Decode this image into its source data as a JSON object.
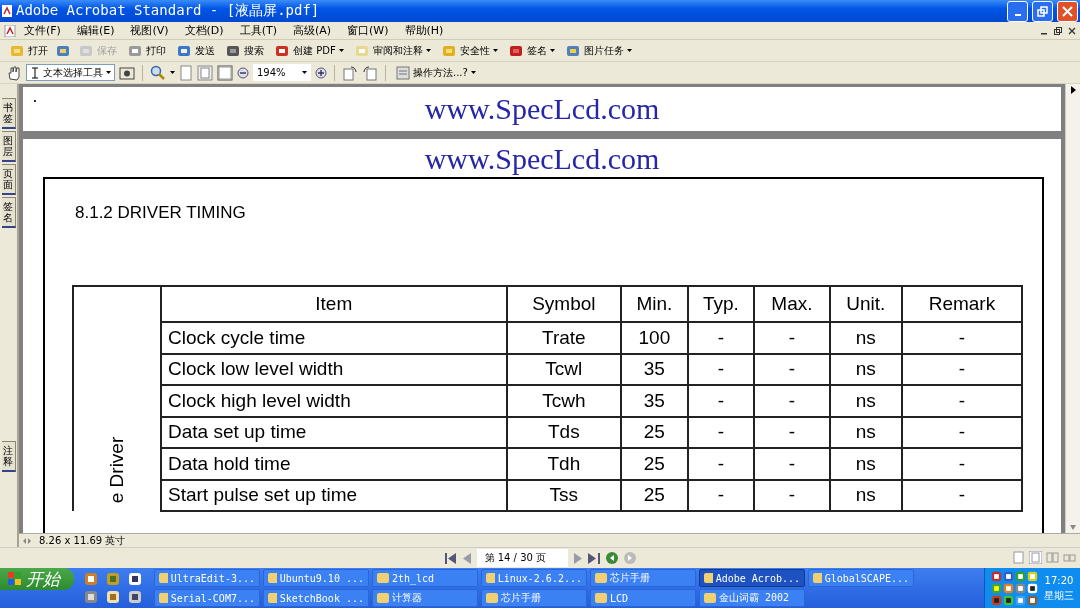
{
  "window": {
    "title": "Adobe Acrobat Standard - [液晶屏.pdf]"
  },
  "menu": [
    "文件(F)",
    "编辑(E)",
    "视图(V)",
    "文档(D)",
    "工具(T)",
    "高级(A)",
    "窗口(W)",
    "帮助(H)"
  ],
  "toolbar": [
    {
      "kind": "button",
      "label": "打开",
      "disabled": false
    },
    {
      "kind": "icon"
    },
    {
      "kind": "button",
      "label": "保存",
      "disabled": true
    },
    {
      "kind": "button",
      "label": "打印",
      "disabled": false
    },
    {
      "kind": "button",
      "label": "发送",
      "disabled": false
    },
    {
      "kind": "button",
      "label": "搜索",
      "disabled": false
    },
    {
      "kind": "menu",
      "label": "创建 PDF"
    },
    {
      "kind": "menu",
      "label": "审阅和注释"
    },
    {
      "kind": "menu",
      "label": "安全性"
    },
    {
      "kind": "menu",
      "label": "签名"
    },
    {
      "kind": "menu",
      "label": "图片任务"
    }
  ],
  "tools": {
    "select_tool": "文本选择工具",
    "zoom": "194%",
    "help": "操作方法...?"
  },
  "side_tabs": [
    {
      "label": "书签"
    },
    {
      "label": "图层"
    },
    {
      "label": "页面"
    },
    {
      "label": "签名"
    }
  ],
  "side_tab_bottom": "注释",
  "document": {
    "watermarks": [
      "www.SpecLcd.com",
      "www.SpecLcd.com"
    ],
    "heading": "8.1.2  DRIVER TIMING",
    "group_label": "e Driver",
    "columns": [
      "Item",
      "Symbol",
      "Min.",
      "Typ.",
      "Max.",
      "Unit.",
      "Remark"
    ],
    "rows": [
      [
        "Clock cycle time",
        "Trate",
        "100",
        "-",
        "-",
        "ns",
        "-"
      ],
      [
        "Clock low level width",
        "Tcwl",
        "35",
        "-",
        "-",
        "ns",
        "-"
      ],
      [
        "Clock high level width",
        "Tcwh",
        "35",
        "-",
        "-",
        "ns",
        "-"
      ],
      [
        "Data set up time",
        "Tds",
        "25",
        "-",
        "-",
        "ns",
        "-"
      ],
      [
        "Data hold time",
        "Tdh",
        "25",
        "-",
        "-",
        "ns",
        "-"
      ],
      [
        "Start pulse set up time",
        "Tss",
        "25",
        "-",
        "-",
        "ns",
        "-"
      ]
    ]
  },
  "page_size": "8.26 x 11.69 英寸",
  "page_indicator": "第 14 / 30 页",
  "taskbar": {
    "start": "开始",
    "tasks": [
      {
        "label": "UltraEdit-3...",
        "selected": false
      },
      {
        "label": "Ubuntu9.10 ...",
        "selected": false
      },
      {
        "label": "2th_lcd",
        "selected": false
      },
      {
        "label": "Linux-2.6.2...",
        "selected": false
      },
      {
        "label": "芯片手册",
        "selected": false
      },
      {
        "label": "Adobe Acrob...",
        "selected": true
      },
      {
        "label": "GlobalSCAPE...",
        "selected": false
      },
      {
        "label": "Serial-COM7...",
        "selected": false
      },
      {
        "label": "SketchBook ...",
        "selected": false
      },
      {
        "label": "计算器",
        "selected": false
      },
      {
        "label": "芯片手册",
        "selected": false
      },
      {
        "label": "LCD",
        "selected": false
      },
      {
        "label": "金山词霸 2002",
        "selected": false
      }
    ],
    "clock": "17:20",
    "day": "星期三"
  }
}
